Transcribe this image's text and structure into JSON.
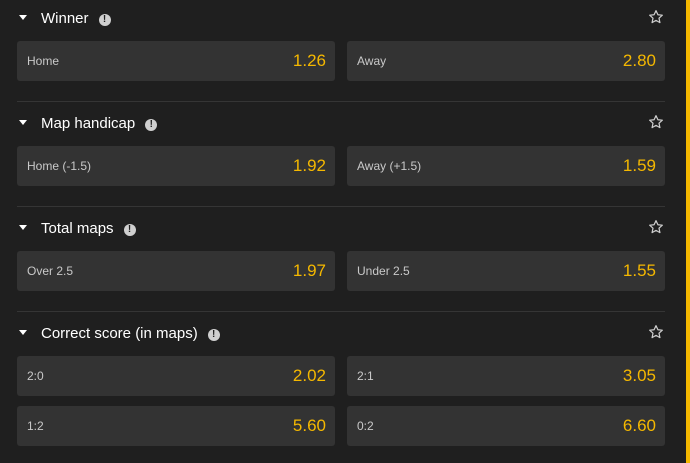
{
  "markets": [
    {
      "title": "Winner",
      "info_glyph": "!",
      "favorite_icon": "star-outline-icon",
      "selections": [
        {
          "label": "Home",
          "odds": "1.26"
        },
        {
          "label": "Away",
          "odds": "2.80"
        }
      ]
    },
    {
      "title": "Map handicap",
      "info_glyph": "!",
      "favorite_icon": "star-outline-icon",
      "selections": [
        {
          "label": "Home (-1.5)",
          "odds": "1.92"
        },
        {
          "label": "Away (+1.5)",
          "odds": "1.59"
        }
      ]
    },
    {
      "title": "Total maps",
      "info_glyph": "!",
      "favorite_icon": "star-outline-icon",
      "selections": [
        {
          "label": "Over 2.5",
          "odds": "1.97"
        },
        {
          "label": "Under 2.5",
          "odds": "1.55"
        }
      ]
    },
    {
      "title": "Correct score (in maps)",
      "info_glyph": "!",
      "favorite_icon": "star-outline-icon",
      "selections": [
        {
          "label": "2:0",
          "odds": "2.02"
        },
        {
          "label": "2:1",
          "odds": "3.05"
        },
        {
          "label": "1:2",
          "odds": "5.60"
        },
        {
          "label": "0:2",
          "odds": "6.60"
        }
      ]
    }
  ],
  "colors": {
    "background": "#1f1f1f",
    "button": "#333333",
    "odds": "#f5b800",
    "label": "#c9c9c9",
    "title": "#ffffff"
  }
}
